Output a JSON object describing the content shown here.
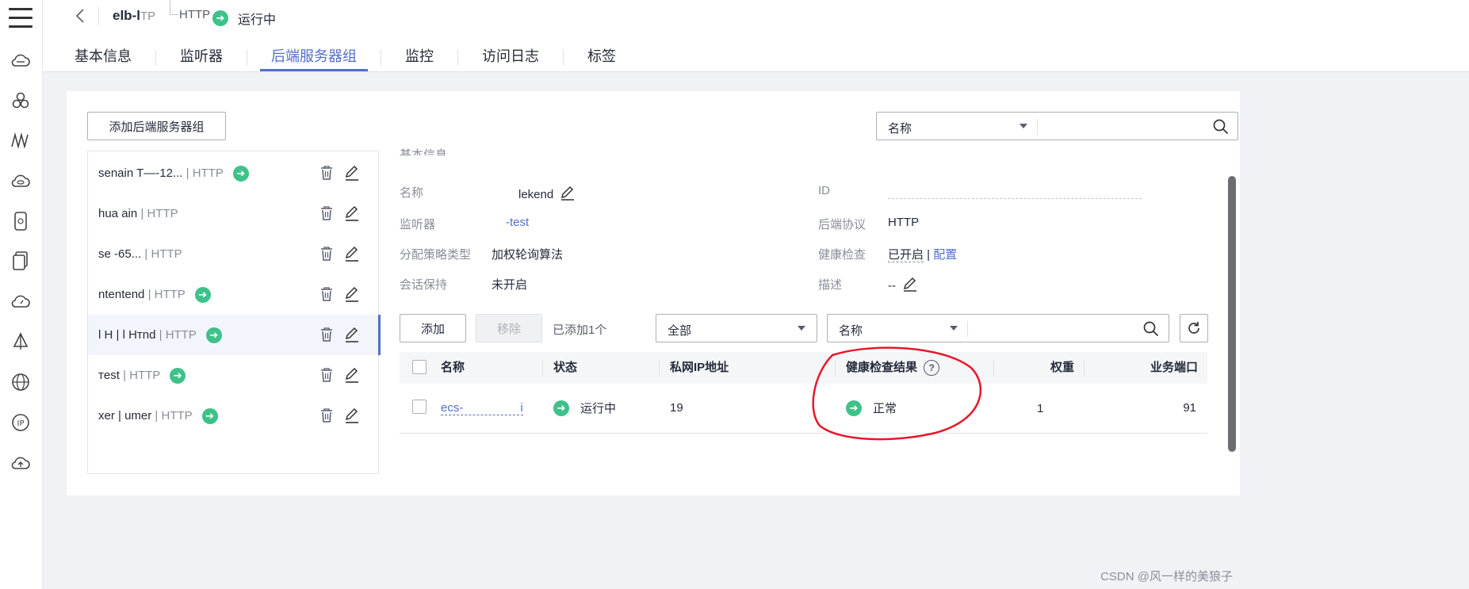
{
  "header": {
    "back_icon": "chevron-left-icon",
    "title": "elb-l",
    "title_tail": "TP",
    "protocol": "HTTP",
    "status": "运行中",
    "tabs": [
      "基本信息",
      "监听器",
      "后端服务器组",
      "监控",
      "访问日志",
      "标签"
    ],
    "active_tab": "后端服务器组"
  },
  "sidebar_icons": [
    "menu-icon",
    "cloud-server-icon",
    "cluster-icon",
    "network-icon",
    "cloud-database-icon",
    "phone-icon",
    "container-icon",
    "cloud-dashboard-icon",
    "sail-icon",
    "globe-icon",
    "ip-icon",
    "cloud-upload-icon"
  ],
  "toolbar": {
    "add_group_label": "添加后端服务器组",
    "filter_select": "名称",
    "search_placeholder": ""
  },
  "groups": [
    {
      "name": "senain   T—-12...",
      "protocol": "| HTTP",
      "running": true
    },
    {
      "name": "hua           ain",
      "protocol": "| HTTP",
      "running": false
    },
    {
      "name": "se            -65...",
      "protocol": "| HTTP",
      "running": false
    },
    {
      "name": "  ntentend",
      "protocol": "| HTTP",
      "running": true
    },
    {
      "name": "l H | l Hтnd",
      "protocol": "| HTTP",
      "running": true,
      "selected": true
    },
    {
      "name": "   тest",
      "protocol": "| HTTP",
      "running": true
    },
    {
      "name": "xer |    umer",
      "protocol": "| HTTP",
      "running": true
    }
  ],
  "details": {
    "section_title": "基本信息",
    "name_label": "名称",
    "name_value": "lekend",
    "id_label": "ID",
    "id_value": "",
    "listener_label": "监听器",
    "listener_value": "-test",
    "backend_protocol_label": "后端协议",
    "backend_protocol_value": "HTTP",
    "lb_label": "分配策略类型",
    "lb_value": "加权轮询算法",
    "health_label": "健康检查",
    "health_value": "已开启",
    "health_sep": " | ",
    "health_link": "配置",
    "session_label": "会话保持",
    "session_value": "未开启",
    "desc_label": "描述",
    "desc_value": "--"
  },
  "members_toolbar": {
    "add_label": "添加",
    "remove_label": "移除",
    "count_text": "已添加1个",
    "scope_select": "全部",
    "filter_select": "名称",
    "search_placeholder": ""
  },
  "table": {
    "headers": [
      "名称",
      "状态",
      "私网IP地址",
      "健康检查结果",
      "权重",
      "业务端口"
    ],
    "rows": [
      {
        "name": "ecs-",
        "name_tail": "i",
        "status": "运行中",
        "ip": "19",
        "health": "正常",
        "weight": "1",
        "port": "91"
      }
    ]
  },
  "annotation_color": "#e8162b",
  "accent_color": "#526ecc",
  "running_color": "#3fc18a",
  "watermark": "CSDN @风一样的美狼子"
}
